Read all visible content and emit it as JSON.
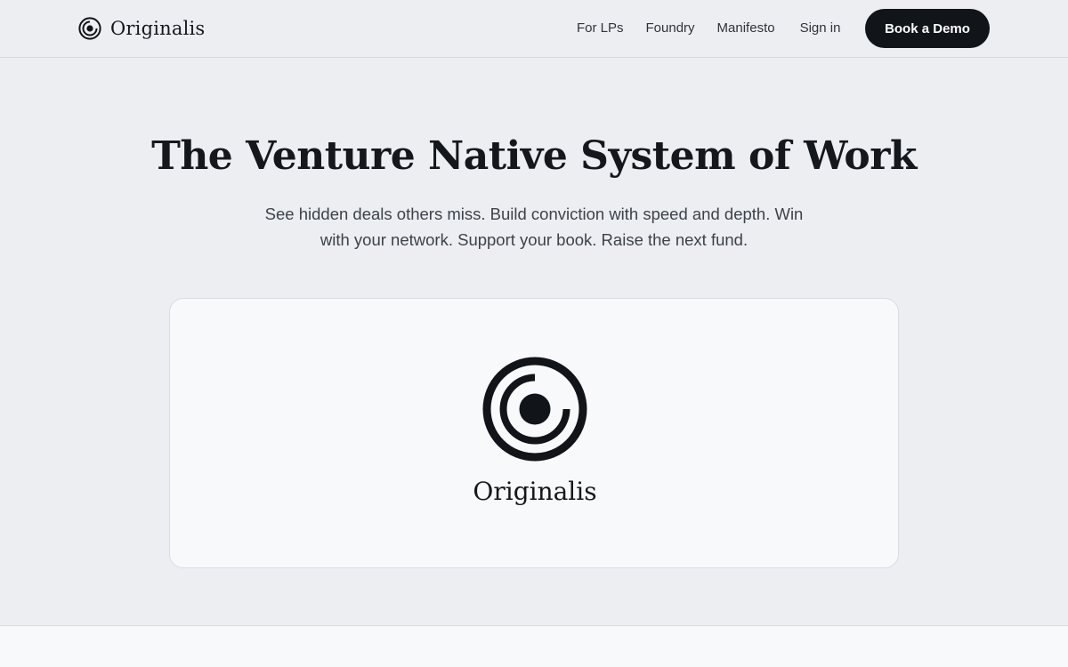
{
  "brand": {
    "name": "Originalis",
    "logo_icon": "concentric-circle-logo"
  },
  "nav": {
    "links": [
      "For LPs",
      "Foundry",
      "Manifesto"
    ],
    "sign_in": "Sign in",
    "cta": "Book a Demo"
  },
  "hero": {
    "title": "The Venture Native System of Work",
    "subtitle": "See hidden deals others miss. Build conviction with speed and depth. Win with your network. Support your book. Raise the next fund."
  },
  "showcase": {
    "logo_icon": "concentric-circle-logo",
    "name": "Originalis"
  },
  "colors": {
    "background": "#eceef2",
    "card": "#f8f9fa",
    "primary": "#111418",
    "text": "#14171c",
    "muted_text": "#3d424a"
  }
}
